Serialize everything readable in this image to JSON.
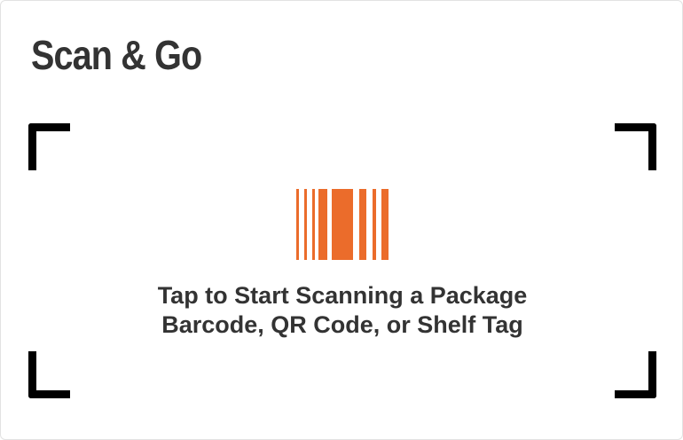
{
  "header": {
    "title": "Scan & Go"
  },
  "scanner": {
    "prompt_line1": "Tap to Start Scanning a Package",
    "prompt_line2": "Barcode, QR Code, or Shelf Tag",
    "icon": "barcode-icon"
  },
  "colors": {
    "accent": "#EB6C2B",
    "text": "#333333",
    "frame": "#000000",
    "background": "#FFFFFF"
  }
}
